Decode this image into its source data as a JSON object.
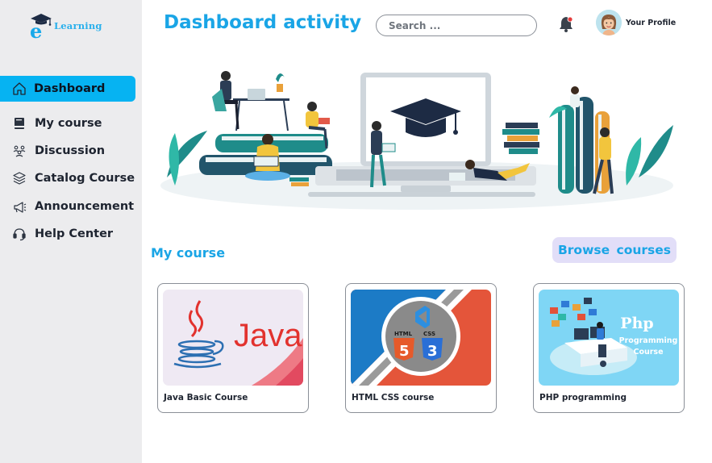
{
  "app": {
    "logo_text": "Learning",
    "logo_letter": "e"
  },
  "sidebar": {
    "items": [
      {
        "label": "Dashboard",
        "icon": "home-icon",
        "active": true
      },
      {
        "label": "My course",
        "icon": "book-icon",
        "active": false
      },
      {
        "label": "Discussion",
        "icon": "people-icon",
        "active": false
      },
      {
        "label": "Catalog Course",
        "icon": "layers-icon",
        "active": false
      },
      {
        "label": "Announcement",
        "icon": "megaphone-icon",
        "active": false
      },
      {
        "label": "Help Center",
        "icon": "headset-icon",
        "active": false
      }
    ]
  },
  "header": {
    "title": "Dashboard activity",
    "search_placeholder": "Search ...",
    "profile_label": "Your Profile",
    "notification_icon": "bell-icon"
  },
  "main": {
    "section_title": "My course",
    "browse_label": "Browse  courses",
    "courses": [
      {
        "name": "Java Basic Course",
        "thumb_text": "Java"
      },
      {
        "name": "HTML CSS course",
        "thumb_text_a": "HTML",
        "thumb_text_b": "CSS",
        "thumb_num_a": "5",
        "thumb_num_b": "3"
      },
      {
        "name": "PHP programming",
        "thumb_title": "Php",
        "thumb_sub_a": "Programming",
        "thumb_sub_b": "Course"
      }
    ]
  },
  "colors": {
    "accent": "#06b3f2",
    "title": "#1aa5e6",
    "sidebar_bg": "#ececee",
    "button_bg": "#e2def8"
  }
}
